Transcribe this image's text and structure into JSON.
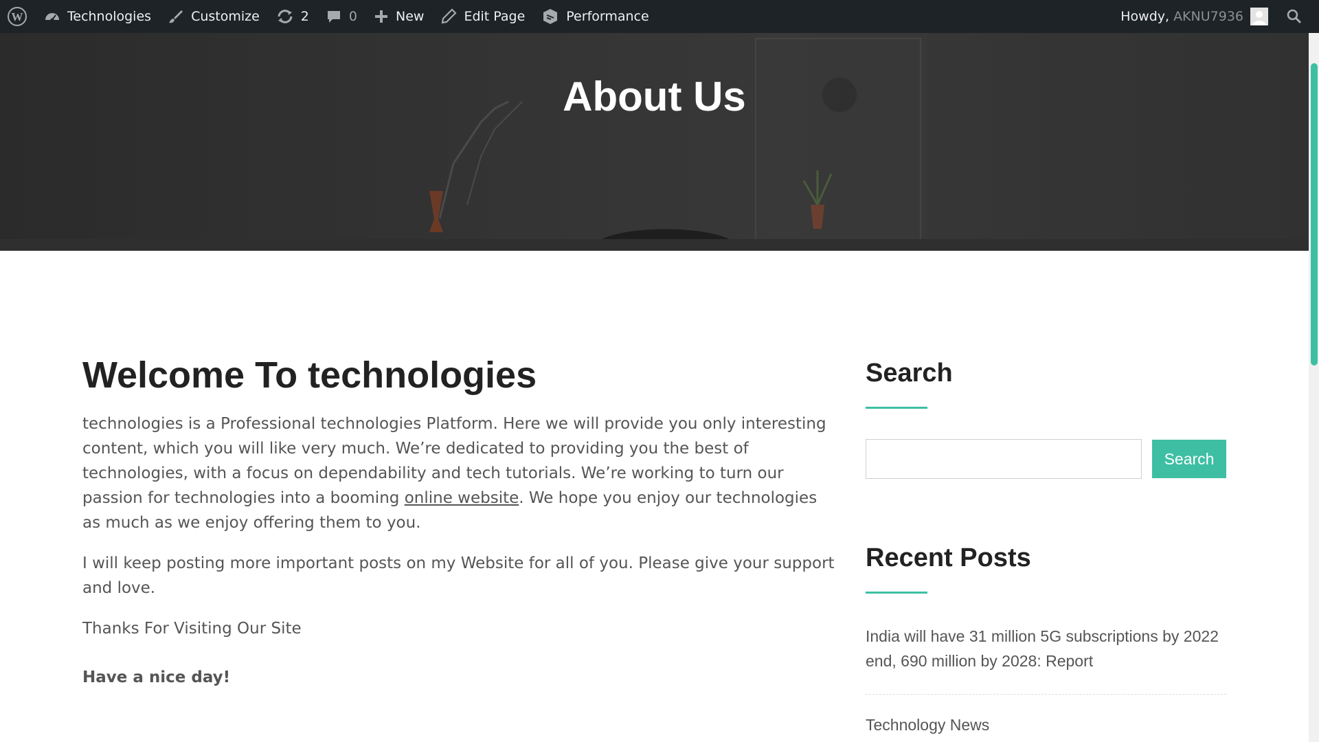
{
  "adminbar": {
    "site_name": "Technologies",
    "customize": "Customize",
    "updates_count": "2",
    "comments_count": "0",
    "new": "New",
    "edit_page": "Edit Page",
    "performance": "Performance",
    "howdy": "Howdy,",
    "username": "AKNU7936"
  },
  "hero": {
    "title": "About Us"
  },
  "main": {
    "heading": "Welcome To technologies",
    "para1_before_link": "technologies is a Professional technologies Platform. Here we will provide you only interesting content, which you will like very much. We’re dedicated to providing you the best of technologies, with a focus on dependability and tech tutorials. We’re working to turn our passion for technologies into a booming ",
    "para1_link": "online website",
    "para1_after_link": ". We hope you enjoy our technologies as much as we enjoy offering them to you.",
    "para2": "I will keep posting more important posts on my Website for all of you. Please give your support and love.",
    "para3": "Thanks For Visiting Our Site",
    "para4": "Have a nice day!"
  },
  "sidebar": {
    "search_title": "Search",
    "search_input_value": "",
    "search_button": "Search",
    "recent_title": "Recent Posts",
    "posts": [
      "India will have 31 million 5G subscriptions by 2022 end, 690 million by 2028: Report",
      "Technology News"
    ]
  },
  "colors": {
    "accent": "#3ebfa4",
    "adminbar_bg": "#1d2327",
    "heading": "#222222",
    "body_text": "#555555"
  },
  "icons": [
    "wordpress-logo-icon",
    "dashboard-icon",
    "brush-icon",
    "updates-icon",
    "comment-icon",
    "plus-icon",
    "pencil-icon",
    "performance-icon",
    "avatar-icon",
    "search-icon"
  ]
}
